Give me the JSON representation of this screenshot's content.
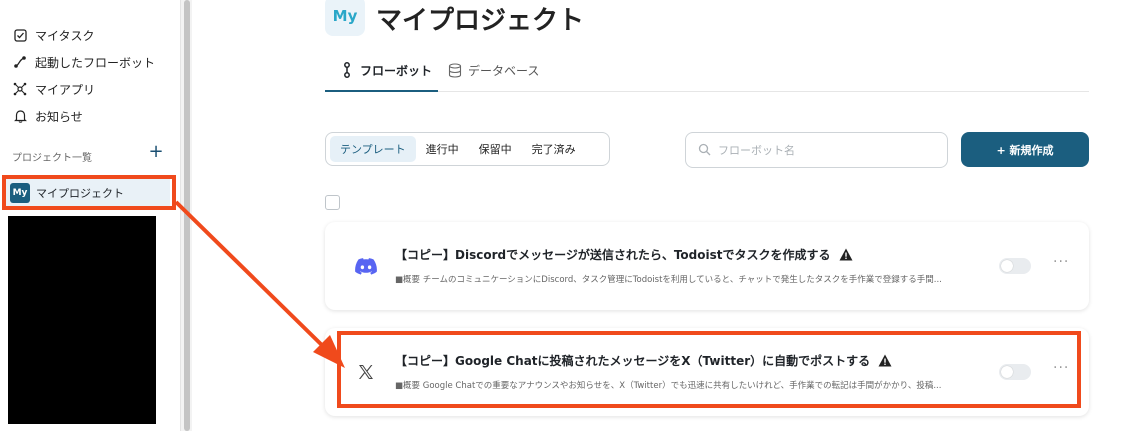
{
  "sidebar": {
    "items": [
      {
        "label": "マイタスク",
        "icon": "checkbox-icon"
      },
      {
        "label": "起動したフローボット",
        "icon": "flow-icon"
      },
      {
        "label": "マイアプリ",
        "icon": "apps-icon"
      },
      {
        "label": "お知らせ",
        "icon": "bell-icon"
      }
    ],
    "projects_label": "プロジェクト一覧",
    "add_icon": "plus-icon",
    "project": {
      "badge": "My",
      "name": "マイプロジェクト"
    }
  },
  "header": {
    "badge": "My",
    "title": "マイプロジェクト"
  },
  "tabs": [
    {
      "label": "フローボット",
      "icon": "flowbot-icon",
      "active": true
    },
    {
      "label": "データベース",
      "icon": "database-icon",
      "active": false
    }
  ],
  "filters": [
    {
      "label": "テンプレート",
      "active": true
    },
    {
      "label": "進行中",
      "active": false
    },
    {
      "label": "保留中",
      "active": false
    },
    {
      "label": "完了済み",
      "active": false
    }
  ],
  "search": {
    "placeholder": "フローボット名",
    "value": ""
  },
  "new_button": {
    "label": "+ 新規作成"
  },
  "cards": [
    {
      "icon": "discord-icon",
      "title": "【コピー】Discordでメッセージが送信されたら、Todoistでタスクを作成する",
      "warning_icon": "warning-icon",
      "description": "■概要 チームのコミュニケーションにDiscord、タスク管理にTodoistを利用していると、チャットで発生したタスクを手作業で登録する手間...",
      "enabled": false
    },
    {
      "icon": "x-twitter-icon",
      "title": "【コピー】Google Chatに投稿されたメッセージをX（Twitter）に自動でポストする",
      "warning_icon": "warning-icon",
      "description": "■概要 Google Chatでの重要なアナウンスやお知らせを、X（Twitter）でも迅速に共有したいけれど、手作業での転記は手間がかかり、投稿...",
      "enabled": false
    }
  ],
  "colors": {
    "accent": "#1b5e7f",
    "highlight": "#f04a1c",
    "badge_text": "#2aa7c8"
  }
}
